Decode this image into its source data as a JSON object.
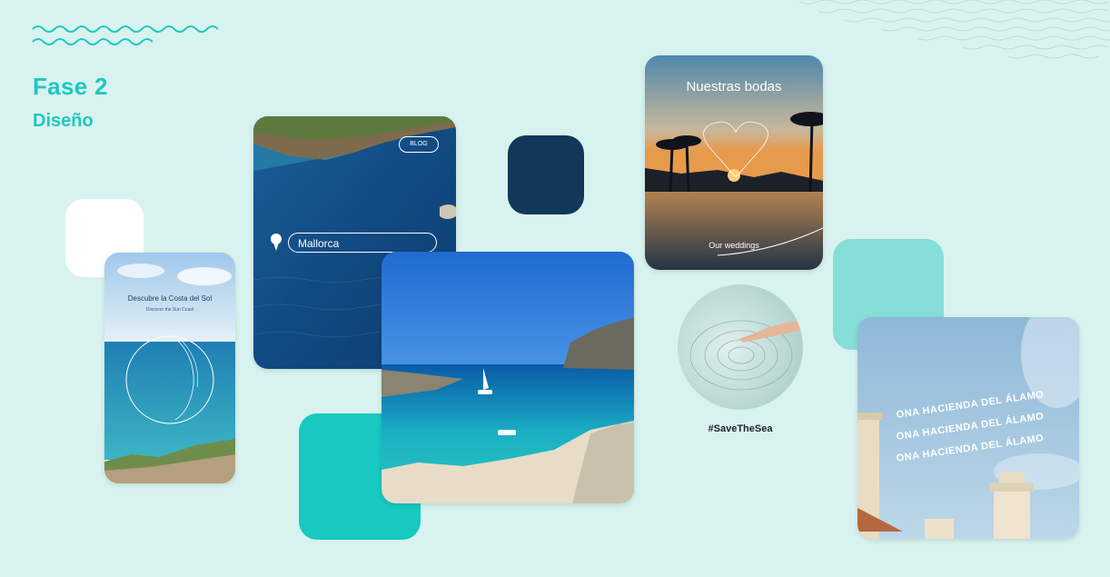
{
  "header": {
    "phase": "Fase 2",
    "subtitle": "Diseño"
  },
  "colors": {
    "background": "#d8f3ef",
    "accent": "#1ec8c0",
    "navy": "#12375a",
    "teal": "#17c9c0",
    "mint": "#86ded8"
  },
  "cards": {
    "costa": {
      "title": "Descubre la Costa del Sol",
      "subtitle": "Discover the Sun Coast"
    },
    "blog": {
      "badge": "BLOG",
      "search_value": "Mallorca",
      "pin_icon": "map-pin-icon"
    },
    "weddings": {
      "title": "Nuestras bodas",
      "subtitle": "Our weddings",
      "icon": "heart-outline-icon"
    },
    "save": {
      "hashtag": "#SaveTheSea"
    },
    "ona": {
      "lines": [
        "ONA HACIENDA DEL ÁLAMO",
        "ONA HACIENDA DEL ÁLAMO",
        "ONA HACIENDA DEL ÁLAMO"
      ]
    }
  }
}
